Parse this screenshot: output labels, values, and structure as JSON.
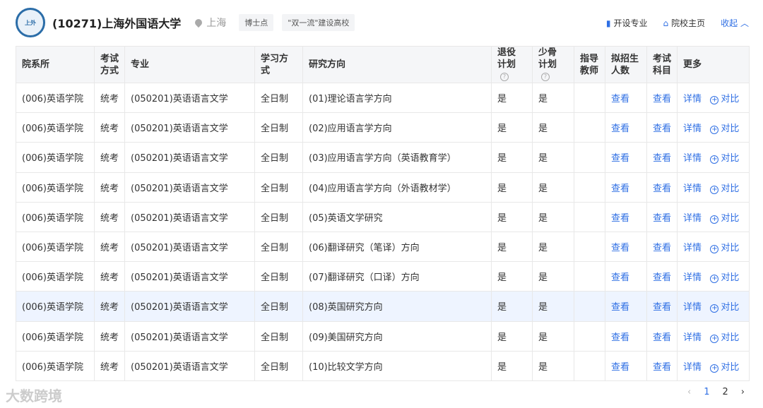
{
  "header": {
    "logo_text": "上外 1949",
    "title": "(10271)上海外国语大学",
    "location": "上海",
    "tags": [
      "博士点",
      "\"双一流\"建设高校"
    ],
    "links": [
      "开设专业",
      "院校主页"
    ],
    "collapse": "收起"
  },
  "table": {
    "headers": [
      "院系所",
      "考试方式",
      "专业",
      "学习方式",
      "研究方向",
      "退役计划",
      "少骨计划",
      "指导教师",
      "拟招生人数",
      "考试科目",
      "更多"
    ],
    "rows": [
      {
        "dept": "(006)英语学院",
        "exam": "统考",
        "major": "(050201)英语语言文学",
        "mode": "全日制",
        "dir": "(01)理论语言学方向",
        "ret": "是",
        "sg": "是",
        "tutor": "",
        "num": "查看",
        "subj": "查看",
        "detail": "详情",
        "compare": "对比"
      },
      {
        "dept": "(006)英语学院",
        "exam": "统考",
        "major": "(050201)英语语言文学",
        "mode": "全日制",
        "dir": "(02)应用语言学方向",
        "ret": "是",
        "sg": "是",
        "tutor": "",
        "num": "查看",
        "subj": "查看",
        "detail": "详情",
        "compare": "对比"
      },
      {
        "dept": "(006)英语学院",
        "exam": "统考",
        "major": "(050201)英语语言文学",
        "mode": "全日制",
        "dir": "(03)应用语言学方向（英语教育学）",
        "ret": "是",
        "sg": "是",
        "tutor": "",
        "num": "查看",
        "subj": "查看",
        "detail": "详情",
        "compare": "对比"
      },
      {
        "dept": "(006)英语学院",
        "exam": "统考",
        "major": "(050201)英语语言文学",
        "mode": "全日制",
        "dir": "(04)应用语言学方向（外语教材学）",
        "ret": "是",
        "sg": "是",
        "tutor": "",
        "num": "查看",
        "subj": "查看",
        "detail": "详情",
        "compare": "对比"
      },
      {
        "dept": "(006)英语学院",
        "exam": "统考",
        "major": "(050201)英语语言文学",
        "mode": "全日制",
        "dir": "(05)英语文学研究",
        "ret": "是",
        "sg": "是",
        "tutor": "",
        "num": "查看",
        "subj": "查看",
        "detail": "详情",
        "compare": "对比"
      },
      {
        "dept": "(006)英语学院",
        "exam": "统考",
        "major": "(050201)英语语言文学",
        "mode": "全日制",
        "dir": "(06)翻译研究（笔译）方向",
        "ret": "是",
        "sg": "是",
        "tutor": "",
        "num": "查看",
        "subj": "查看",
        "detail": "详情",
        "compare": "对比"
      },
      {
        "dept": "(006)英语学院",
        "exam": "统考",
        "major": "(050201)英语语言文学",
        "mode": "全日制",
        "dir": "(07)翻译研究（口译）方向",
        "ret": "是",
        "sg": "是",
        "tutor": "",
        "num": "查看",
        "subj": "查看",
        "detail": "详情",
        "compare": "对比"
      },
      {
        "dept": "(006)英语学院",
        "exam": "统考",
        "major": "(050201)英语语言文学",
        "mode": "全日制",
        "dir": "(08)英国研究方向",
        "ret": "是",
        "sg": "是",
        "tutor": "",
        "num": "查看",
        "subj": "查看",
        "detail": "详情",
        "compare": "对比"
      },
      {
        "dept": "(006)英语学院",
        "exam": "统考",
        "major": "(050201)英语语言文学",
        "mode": "全日制",
        "dir": "(09)美国研究方向",
        "ret": "是",
        "sg": "是",
        "tutor": "",
        "num": "查看",
        "subj": "查看",
        "detail": "详情",
        "compare": "对比"
      },
      {
        "dept": "(006)英语学院",
        "exam": "统考",
        "major": "(050201)英语语言文学",
        "mode": "全日制",
        "dir": "(10)比较文学方向",
        "ret": "是",
        "sg": "是",
        "tutor": "",
        "num": "查看",
        "subj": "查看",
        "detail": "详情",
        "compare": "对比"
      }
    ]
  },
  "watermark": "大数跨境",
  "pagination": {
    "pages": [
      "1",
      "2"
    ],
    "current": "1"
  },
  "colors": {
    "accent": "#2f6fe4",
    "highlight_row": "#eef4ff"
  }
}
